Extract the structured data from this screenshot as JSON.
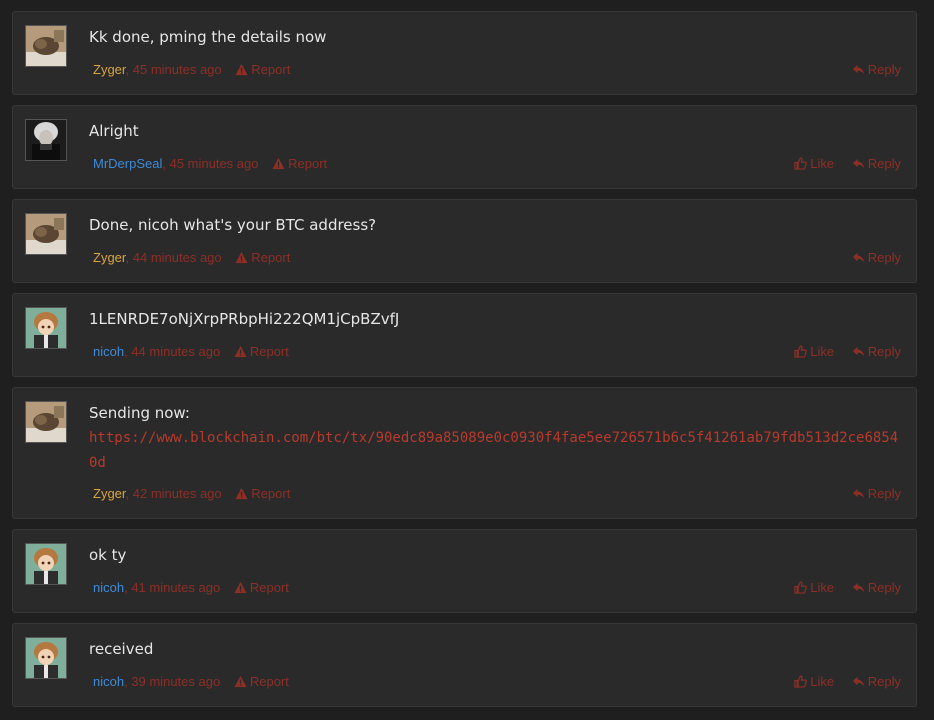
{
  "colors": {
    "zyger": "#d9a441",
    "blue_user": "#3d8bd8",
    "meta_red": "#8e2f26",
    "link_red": "#b83a2c"
  },
  "labels": {
    "report": "Report",
    "like": "Like",
    "reply": "Reply"
  },
  "posts": [
    {
      "author": "Zyger",
      "time": "45 minutes ago",
      "lines": [
        "Kk done, pming the details now"
      ],
      "avatar": "brown-photo"
    },
    {
      "author": "MrDerpSeal",
      "time": "45 minutes ago",
      "lines": [
        "Alright"
      ],
      "avatar": "white-hair-character"
    },
    {
      "author": "Zyger",
      "time": "44 minutes ago",
      "lines": [
        "Done, nicoh what's your BTC address?"
      ],
      "avatar": "brown-photo"
    },
    {
      "author": "nicoh",
      "time": "44 minutes ago",
      "lines": [
        "1LENRDE7oNjXrpPRbpHi222QM1jCpBZvfJ"
      ],
      "avatar": "anime-character"
    },
    {
      "author": "Zyger",
      "time": "42 minutes ago",
      "lines": [
        "Sending now:"
      ],
      "link": "https://www.blockchain.com/btc/tx/90edc89a85089e0c0930f4fae5ee726571b6c5f41261ab79fdb513d2ce68540d",
      "avatar": "brown-photo"
    },
    {
      "author": "nicoh",
      "time": "41 minutes ago",
      "lines": [
        "ok ty"
      ],
      "avatar": "anime-character"
    },
    {
      "author": "nicoh",
      "time": "39 minutes ago",
      "lines": [
        "received"
      ],
      "avatar": "anime-character"
    }
  ]
}
